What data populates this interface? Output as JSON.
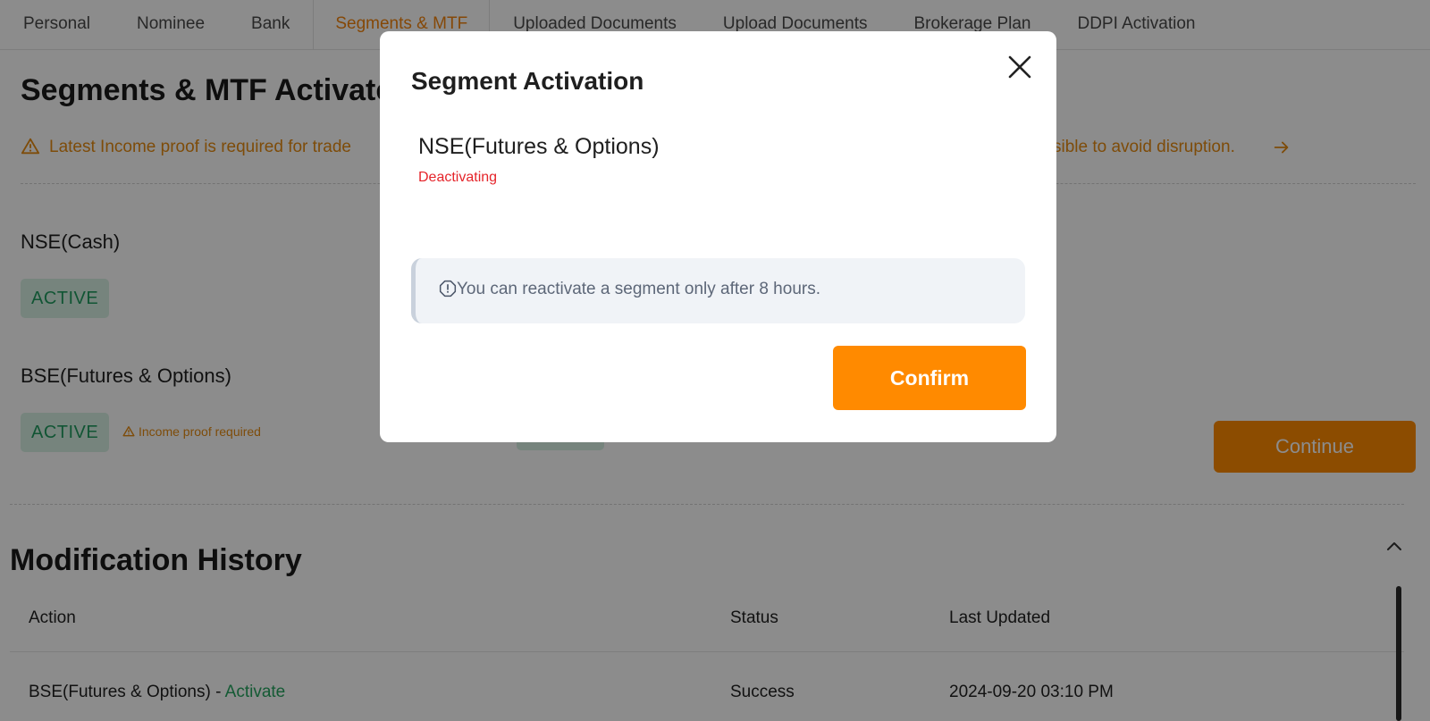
{
  "tabs": [
    {
      "label": "Personal"
    },
    {
      "label": "Nominee"
    },
    {
      "label": "Bank"
    },
    {
      "label": "Segments & MTF"
    },
    {
      "label": "Uploaded Documents"
    },
    {
      "label": "Upload Documents"
    },
    {
      "label": "Brokerage Plan"
    },
    {
      "label": "DDPI Activation"
    }
  ],
  "page": {
    "title": "Segments & MTF Activate",
    "warning_left": "Latest Income proof is required for trade",
    "warning_right": "sible to avoid disruption.",
    "segments": [
      {
        "name": "NSE(Cash)",
        "status": "ACTIVE"
      },
      {
        "name": "BSE(Futures & Options)",
        "status": "ACTIVE",
        "note": "Income proof required"
      }
    ],
    "continue_label": "Continue"
  },
  "history": {
    "title": "Modification History",
    "columns": [
      "Action",
      "Status",
      "Last Updated"
    ],
    "rows": [
      {
        "segment": "BSE(Futures & Options) - ",
        "action": "Activate",
        "status": "Success",
        "updated": "2024-09-20 03:10 PM"
      }
    ]
  },
  "modal": {
    "title": "Segment Activation",
    "segment_name": "NSE(Futures & Options)",
    "segment_status": "Deactivating",
    "info_text": "You can reactivate a segment only after 8 hours.",
    "confirm_label": "Confirm"
  },
  "colors": {
    "accent": "#ff8a00",
    "active_tab": "#f2840e",
    "active_badge_bg": "#d7f1e3",
    "active_badge_text": "#1f9b5f",
    "warning": "#e58a12",
    "danger": "#e5242a"
  },
  "icons": {
    "warning": "warning-triangle-icon",
    "arrow": "arrow-right-icon",
    "close": "close-icon",
    "info": "info-octagon-icon",
    "chevron": "chevron-up-icon"
  }
}
